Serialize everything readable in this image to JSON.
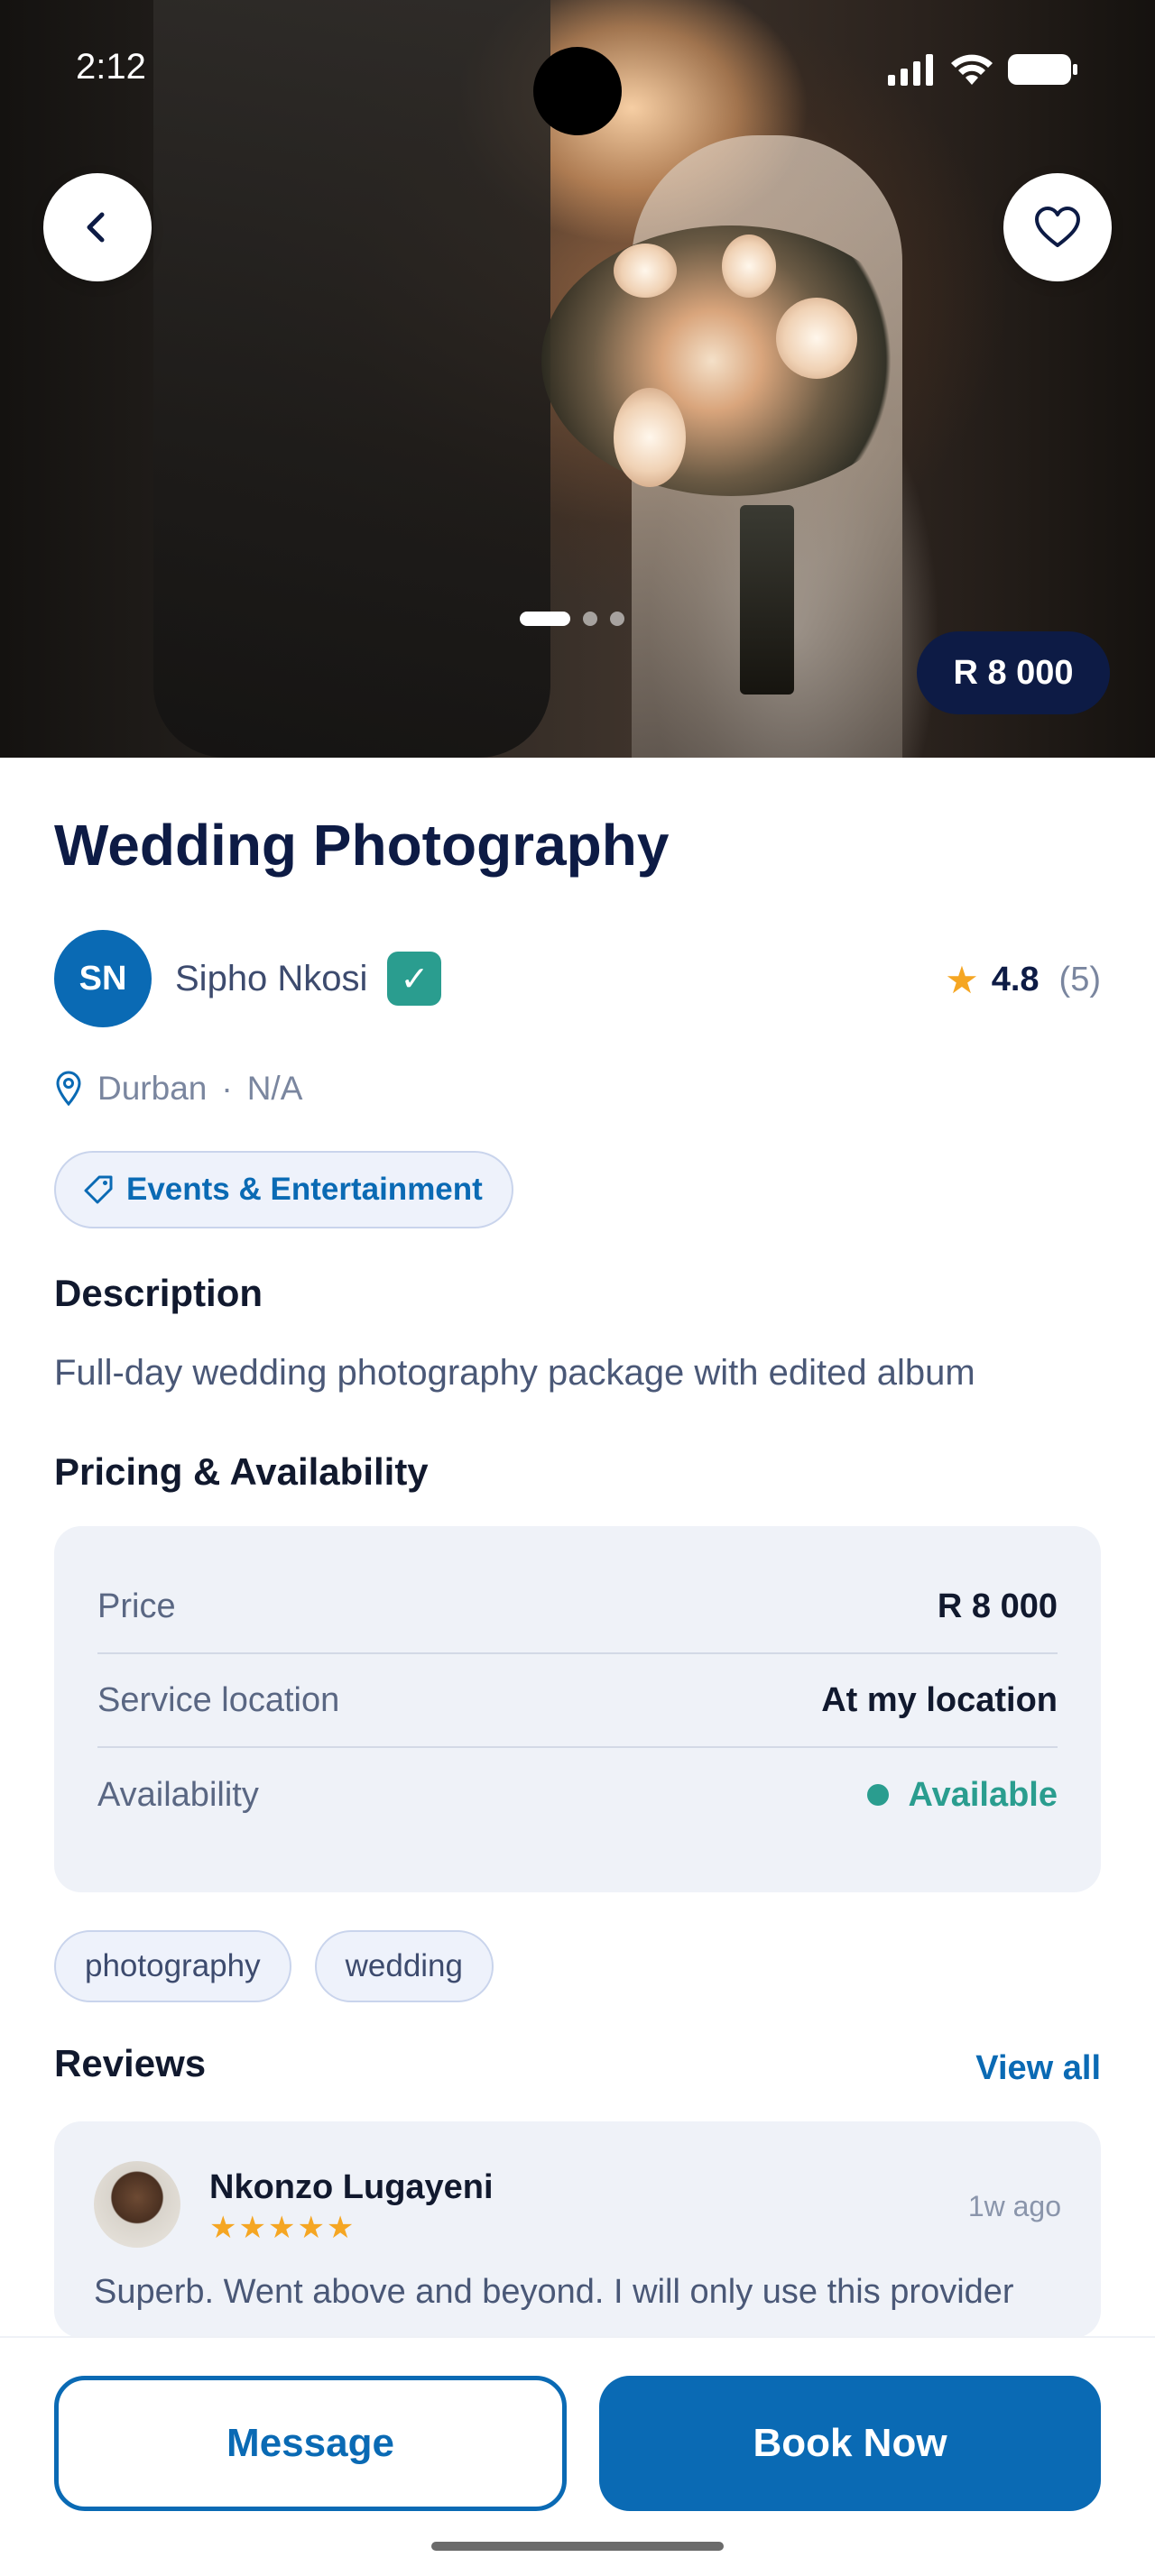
{
  "status_bar": {
    "time": "2:12"
  },
  "hero": {
    "price": "R 8 000",
    "image_count": 3,
    "active_image": 1
  },
  "service": {
    "title": "Wedding Photography",
    "provider": {
      "initials": "SN",
      "name": "Sipho Nkosi",
      "verified": true
    },
    "rating": {
      "score": "4.8",
      "count": "(5)"
    },
    "location": {
      "city": "Durban",
      "separator": "·",
      "area": "N/A"
    },
    "category": "Events & Entertainment"
  },
  "description": {
    "heading": "Description",
    "text": "Full-day wedding photography package with edited album"
  },
  "pricing": {
    "heading": "Pricing & Availability",
    "rows": [
      {
        "label": "Price",
        "value": "R 8 000"
      },
      {
        "label": "Service location",
        "value": "At my location"
      },
      {
        "label": "Availability",
        "value": "Available"
      }
    ]
  },
  "tags": [
    "photography",
    "wedding"
  ],
  "reviews": {
    "heading": "Reviews",
    "view_all": "View all",
    "items": [
      {
        "author": "Nkonzo Lugayeni",
        "stars": "★★★★★",
        "time": "1w ago",
        "text": "Superb. Went above and beyond. I will only use this provider"
      }
    ]
  },
  "actions": {
    "message": "Message",
    "book": "Book Now"
  },
  "colors": {
    "primary": "#0a6ab4",
    "navy": "#0d1b45",
    "success": "#2a9d8f",
    "star": "#f5a623",
    "card_bg": "#eff2f8"
  }
}
